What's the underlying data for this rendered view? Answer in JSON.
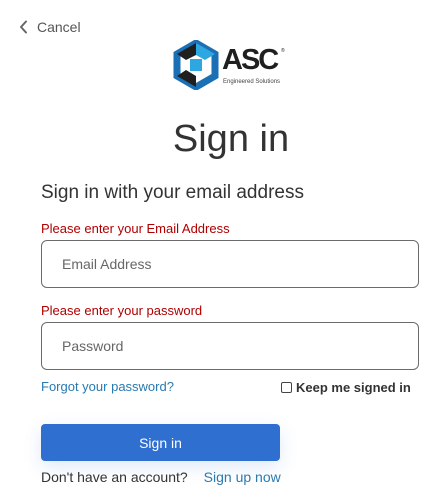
{
  "header": {
    "cancel_label": "Cancel"
  },
  "logo": {
    "wordmark": "ASC",
    "registered": "®",
    "tagline": "Engineered Solutions",
    "colors": {
      "primary": "#1a6fb5",
      "accent": "#2ea7e0",
      "dark": "#1f1f1f"
    }
  },
  "form": {
    "title": "Sign in",
    "subtitle": "Sign in with your email address",
    "email": {
      "error": "Please enter your Email Address",
      "placeholder": "Email Address",
      "value": ""
    },
    "password": {
      "error": "Please enter your password",
      "placeholder": "Password",
      "value": ""
    },
    "forgot_label": "Forgot your password?",
    "keep_signed_in_label": "Keep me signed in",
    "keep_signed_in_checked": false,
    "submit_label": "Sign in",
    "no_account_text": "Don't have an account?",
    "sign_up_label": "Sign up now"
  },
  "colors": {
    "error": "#b00000",
    "link": "#2a7ab0",
    "button": "#2f6fcf"
  },
  "icons": {
    "back": "chevron-left-icon",
    "logo": "hexagon-logo-icon",
    "checkbox": "checkbox-unchecked-icon"
  }
}
